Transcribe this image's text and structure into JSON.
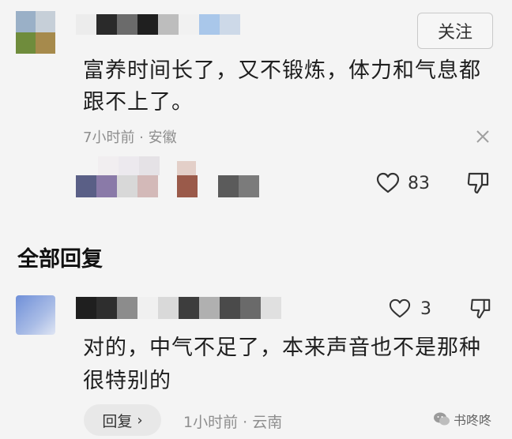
{
  "comment": {
    "follow_label": "关注",
    "text": "富养时间长了，又不锻炼，体力和气息都跟不上了。",
    "meta": "7小时前 · 安徽",
    "like_count": "83"
  },
  "replies_section": {
    "title": "全部回复"
  },
  "reply": {
    "like_count": "3",
    "text": "对的，中气不足了，本来声音也不是那种很特别的",
    "reply_label": "回复",
    "meta": "1小时前 · 云南"
  },
  "watermark": {
    "text": "书咚咚"
  },
  "icons": {
    "close": "close-icon",
    "like": "heart-icon",
    "dislike": "thumbs-down-icon",
    "chevron": "chevron-right-icon",
    "wechat": "wechat-icon"
  },
  "colors": {
    "background": "#f4f4f4",
    "text_primary": "#1e1e1e",
    "text_secondary": "#8e8e8e"
  }
}
